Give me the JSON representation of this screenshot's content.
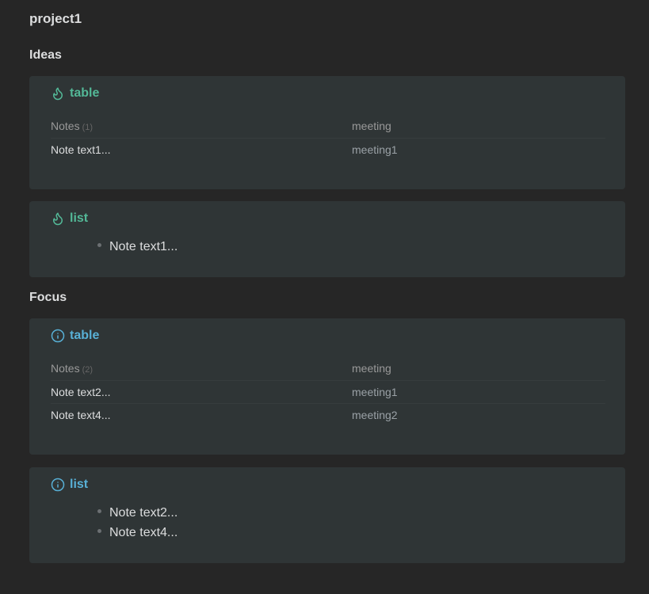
{
  "page": {
    "title": "project1"
  },
  "sections": [
    {
      "heading": "Ideas",
      "table": {
        "title": "table",
        "icon": "fire-icon",
        "color": "#53b897",
        "columns": {
          "notes": "Notes",
          "count": "(1)",
          "meeting": "meeting"
        },
        "rows": [
          {
            "note": "Note text1...",
            "meeting": "meeting1"
          }
        ]
      },
      "list": {
        "title": "list",
        "icon": "fire-icon",
        "color": "#53b897",
        "items": [
          "Note text1..."
        ]
      }
    },
    {
      "heading": "Focus",
      "table": {
        "title": "table",
        "icon": "info-icon",
        "color": "#58b0d6",
        "columns": {
          "notes": "Notes",
          "count": "(2)",
          "meeting": "meeting"
        },
        "rows": [
          {
            "note": "Note text2...",
            "meeting": "meeting1"
          },
          {
            "note": "Note text4...",
            "meeting": "meeting2"
          }
        ]
      },
      "list": {
        "title": "list",
        "icon": "info-icon",
        "color": "#58b0d6",
        "items": [
          "Note text2...",
          "Note text4..."
        ]
      }
    }
  ]
}
